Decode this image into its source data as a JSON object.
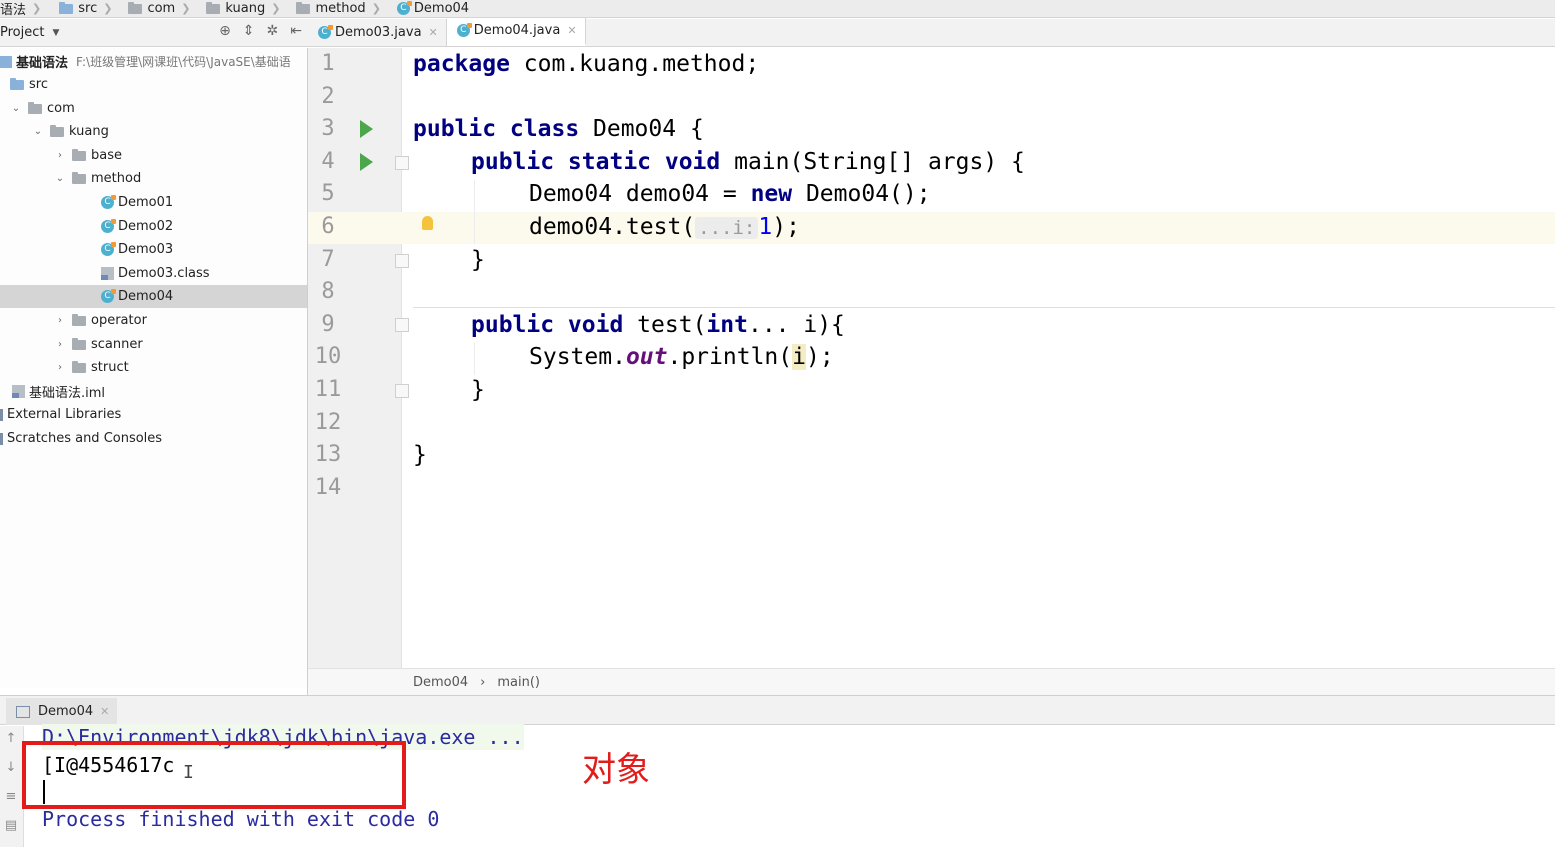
{
  "breadcrumb": [
    "语法",
    "src",
    "com",
    "kuang",
    "method",
    "Demo04"
  ],
  "project_panel": {
    "title": "Project"
  },
  "tabs": [
    {
      "label": "Demo03.java",
      "active": false
    },
    {
      "label": "Demo04.java",
      "active": true
    }
  ],
  "tree": {
    "root_label": "基础语法",
    "root_path": "F:\\班级管理\\网课班\\代码\\JavaSE\\基础语",
    "src": "src",
    "com": "com",
    "kuang": "kuang",
    "base": "base",
    "method": "method",
    "demo01": "Demo01",
    "demo02": "Demo02",
    "demo03": "Demo03",
    "demo03_class": "Demo03.class",
    "demo04": "Demo04",
    "operator": "operator",
    "scanner": "scanner",
    "struct": "struct",
    "iml": "基础语法.iml",
    "external_libraries": "External Libraries",
    "scratches": "Scratches and Consoles"
  },
  "editor": {
    "line_numbers": [
      "1",
      "2",
      "3",
      "4",
      "5",
      "6",
      "7",
      "8",
      "9",
      "10",
      "11",
      "12",
      "13",
      "14"
    ],
    "l1_kw": "package",
    "l1_rest": " com.kuang.method;",
    "l3_kw": "public class",
    "l3_rest": " Demo04 {",
    "l4_kw1": "public static void",
    "l4_rest": " main(String[] args) {",
    "l5_a": "Demo04 demo04 = ",
    "l5_kw": "new",
    "l5_b": " Demo04();",
    "l6_a": "demo04.test(",
    "l6_hint": "...i:",
    "l6_num": "1",
    "l6_b": ");",
    "l7": "}",
    "l9_kw1": "public void",
    "l9_mid": " test(",
    "l9_kw2": "int",
    "l9_rest": "... i){",
    "l10_a": "System.",
    "l10_field": "out",
    "l10_b": ".println(",
    "l10_param": "i",
    "l10_c": ");",
    "l11": "}",
    "l13": "}"
  },
  "editor_breadcrumb": {
    "class": "Demo04",
    "method": "main()"
  },
  "run_panel": {
    "tab_label": "Demo04",
    "command": "D:\\Environment\\jdk8\\jdk\\bin\\java.exe ...",
    "output": "[I@4554617c",
    "exit": "Process finished with exit code 0"
  },
  "annotation": "对象",
  "colors": {
    "annotation_red": "#e21b1b",
    "keyword": "#000080",
    "number": "#0000ff"
  }
}
